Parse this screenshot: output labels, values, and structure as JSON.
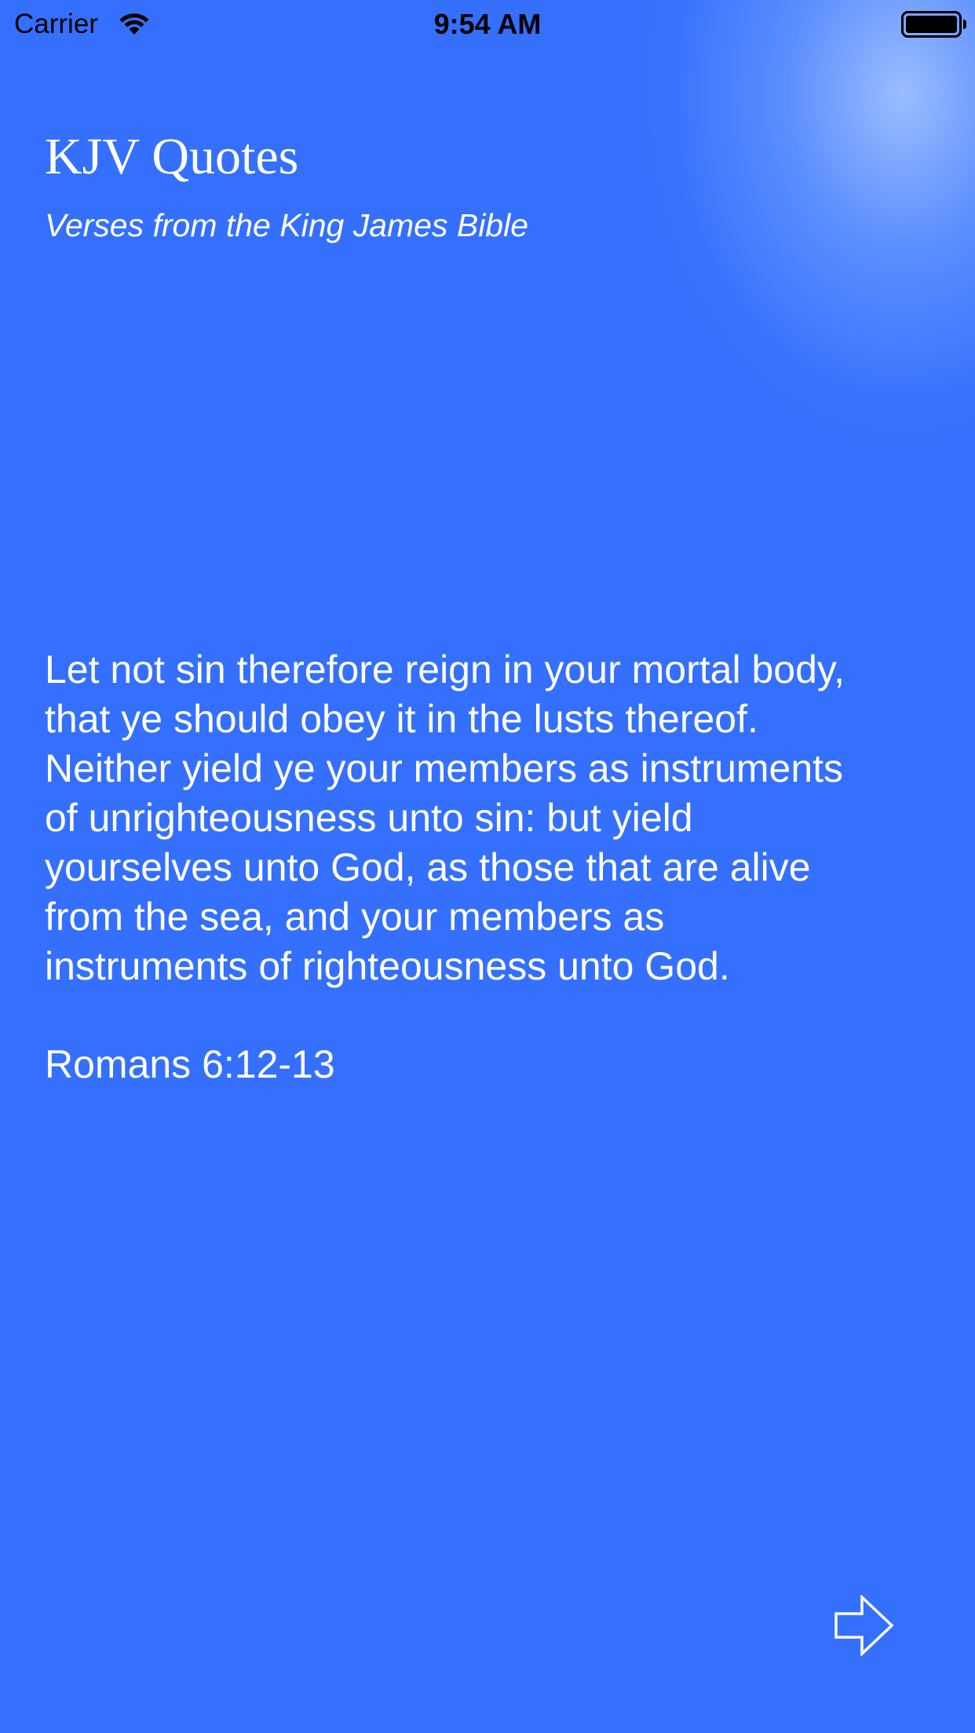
{
  "status_bar": {
    "carrier": "Carrier",
    "time": "9:54 AM",
    "wifi_icon": "wifi-icon",
    "battery_icon": "battery-icon"
  },
  "header": {
    "title": "KJV Quotes",
    "subtitle": "Verses from the King James Bible"
  },
  "verse": {
    "lines": [
      "Let not sin therefore reign in your mortal body,",
      "that ye should obey it in the lusts thereof.",
      "Neither yield ye your members as instruments",
      "of unrighteousness unto sin: but yield",
      "yourselves unto God, as those that are alive",
      "from the sea, and your members as",
      "instruments of righteousness unto God."
    ],
    "reference": "Romans 6:12-13"
  },
  "controls": {
    "next_icon": "arrow-right-icon"
  },
  "colors": {
    "background": "#3470FD",
    "text": "#FFFFFF",
    "status_text": "#000000"
  }
}
